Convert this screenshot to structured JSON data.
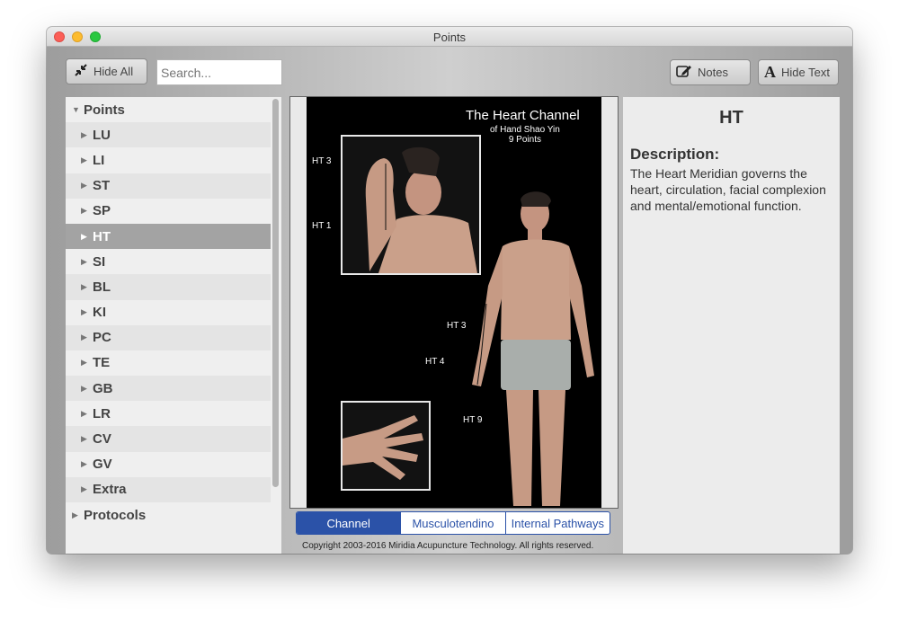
{
  "window": {
    "title": "Points"
  },
  "toolbar": {
    "hide_all_label": "Hide All",
    "search_placeholder": "Search...",
    "notes_label": "Notes",
    "hide_text_label": "Hide Text"
  },
  "sidebar": {
    "root_label": "Points",
    "items": [
      {
        "label": "LU"
      },
      {
        "label": "LI"
      },
      {
        "label": "ST"
      },
      {
        "label": "SP"
      },
      {
        "label": "HT",
        "selected": true
      },
      {
        "label": "SI"
      },
      {
        "label": "BL"
      },
      {
        "label": "KI"
      },
      {
        "label": "PC"
      },
      {
        "label": "TE"
      },
      {
        "label": "GB"
      },
      {
        "label": "LR"
      },
      {
        "label": "CV"
      },
      {
        "label": "GV"
      },
      {
        "label": "Extra"
      }
    ],
    "protocols_label": "Protocols"
  },
  "chart": {
    "title": "The Heart Channel",
    "subtitle1": "of Hand Shao Yin",
    "subtitle2": "9 Points",
    "labels": {
      "ht3_inset": "HT 3",
      "ht1_inset": "HT 1",
      "ht3": "HT 3",
      "ht4": "HT 4",
      "ht9": "HT 9"
    }
  },
  "tabs": [
    {
      "label": "Channel",
      "active": true
    },
    {
      "label": "Musculotendino",
      "active": false
    },
    {
      "label": "Internal Pathways",
      "active": false
    }
  ],
  "footer": {
    "copyright": "Copyright 2003-2016 Miridia Acupuncture Technology.  All rights reserved."
  },
  "detail": {
    "code": "HT",
    "heading": "Description:",
    "text": "The Heart Meridian governs the heart, circulation, facial complexion and mental/emotional function."
  },
  "colors": {
    "accent": "#2b52a8",
    "selected_row": "#a3a3a3"
  }
}
